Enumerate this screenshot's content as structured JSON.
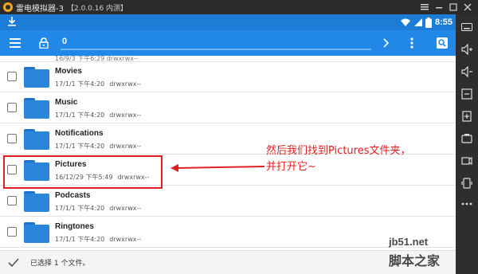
{
  "window": {
    "title": "雷电模拟器-3",
    "version": "【2.0.0.16 内测】"
  },
  "statusbar": {
    "time": "8:55"
  },
  "toolbar": {
    "path": "0"
  },
  "files": [
    {
      "name": "Movies",
      "date": "17/1/1 下午4:20",
      "perms": "drwxrwx--"
    },
    {
      "name": "Music",
      "date": "17/1/1 下午4:20",
      "perms": "drwxrwx--"
    },
    {
      "name": "Notifications",
      "date": "17/1/1 下午4:20",
      "perms": "drwxrwx--"
    },
    {
      "name": "Pictures",
      "date": "16/12/29 下午5:49",
      "perms": "drwxrwx--"
    },
    {
      "name": "Podcasts",
      "date": "17/1/1 下午4:20",
      "perms": "drwxrwx--"
    },
    {
      "name": "Ringtones",
      "date": "17/1/1 下午4:20",
      "perms": "drwxrwx--"
    }
  ],
  "partial_top_meta": "16/9/3 下午6:29 drwxrwx--",
  "bottom": {
    "selected": "已选择 1 个文件。"
  },
  "annotation": {
    "line1": "然后我们找到Pictures文件夹，",
    "line2": "并打开它~"
  },
  "watermark": {
    "site": "jb51.net",
    "name": "脚本之家"
  },
  "colors": {
    "toolbar": "#2188e8",
    "statusbar": "#1c7cd6",
    "folder": "#2a86db",
    "annotation": "#e02020"
  }
}
